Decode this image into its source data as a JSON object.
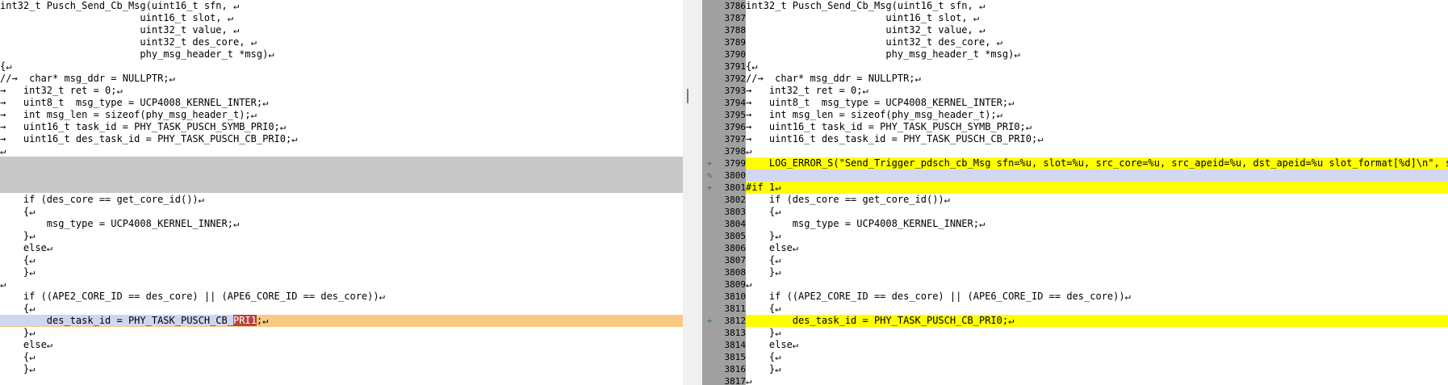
{
  "left": {
    "lines_top": [
      "int32_t Pusch_Send_Cb_Msg(uint16_t sfn, ↵",
      "                        uint16_t slot, ↵",
      "                        uint32_t value, ↵",
      "                        uint32_t des_core, ↵",
      "                        phy_msg_header_t *msg)↵",
      "{↵",
      "//→  char* msg_ddr = NULLPTR;↵",
      "→   int32_t ret = 0;↵",
      "→   uint8_t  msg_type = UCP4008_KERNEL_INTER;↵",
      "→   int msg_len = sizeof(phy_msg_header_t);↵",
      "→   uint16_t task_id = PHY_TASK_PUSCH_SYMB_PRI0;↵",
      "→   uint16_t des_task_id = PHY_TASK_PUSCH_CB_PRI0;↵",
      "↵"
    ],
    "lines_bottom": [
      "    if (des_core == get_core_id())↵",
      "    {↵",
      "        msg_type = UCP4008_KERNEL_INNER;↵",
      "    }↵",
      "    else↵",
      "    {↵",
      "    }↵",
      "↵",
      "    if ((APE2_CORE_ID == des_core) || (APE6_CORE_ID == des_core))↵",
      "    {↵"
    ],
    "changed_line": {
      "prefix": "        des_task_id = PHY_TASK_PUSCH_CB_",
      "deleted": "PRI1",
      "suffix": ";↵"
    },
    "lines_after": [
      "    }↵",
      "    else↵",
      "    {↵",
      "    }↵"
    ]
  },
  "right": {
    "lines": [
      {
        "n": "3786",
        "t": "int32_t Pusch_Send_Cb_Msg(uint16_t sfn, ↵"
      },
      {
        "n": "3787",
        "t": "                        uint16_t slot, ↵"
      },
      {
        "n": "3788",
        "t": "                        uint32_t value, ↵"
      },
      {
        "n": "3789",
        "t": "                        uint32_t des_core, ↵"
      },
      {
        "n": "3790",
        "t": "                        phy_msg_header_t *msg)↵"
      },
      {
        "n": "3791",
        "t": "{↵"
      },
      {
        "n": "3792",
        "t": "//→  char* msg_ddr = NULLPTR;↵"
      },
      {
        "n": "3793",
        "t": "→   int32_t ret = 0;↵"
      },
      {
        "n": "3794",
        "t": "→   uint8_t  msg_type = UCP4008_KERNEL_INTER;↵"
      },
      {
        "n": "3795",
        "t": "→   int msg_len = sizeof(phy_msg_header_t);↵"
      },
      {
        "n": "3796",
        "t": "→   uint16_t task_id = PHY_TASK_PUSCH_SYMB_PRI0;↵"
      },
      {
        "n": "3797",
        "t": "→   uint16_t des_task_id = PHY_TASK_PUSCH_CB_PRI0;↵"
      },
      {
        "n": "3798",
        "t": "↵"
      },
      {
        "n": "3799",
        "t": "    LOG_ERROR_S(\"Send_Trigger_pdsch_cb_Msg sfn=%u, slot=%u, src_core=%u, src_apeid=%u, dst_apeid=%u slot_format[%d]\\n\", sfn,",
        "hl": "yellow",
        "mark": "+"
      },
      {
        "n": "3800",
        "t": "",
        "hl": "lav",
        "mark": "✎"
      },
      {
        "n": "3801",
        "t": "#if 1↵",
        "hl": "yellow",
        "mark": "+"
      },
      {
        "n": "3802",
        "t": "    if (des_core == get_core_id())↵"
      },
      {
        "n": "3803",
        "t": "    {↵"
      },
      {
        "n": "3804",
        "t": "        msg_type = UCP4008_KERNEL_INNER;↵"
      },
      {
        "n": "3805",
        "t": "    }↵"
      },
      {
        "n": "3806",
        "t": "    else↵"
      },
      {
        "n": "3807",
        "t": "    {↵"
      },
      {
        "n": "3808",
        "t": "    }↵"
      },
      {
        "n": "3809",
        "t": "↵"
      },
      {
        "n": "3810",
        "t": "    if ((APE2_CORE_ID == des_core) || (APE6_CORE_ID == des_core))↵"
      },
      {
        "n": "3811",
        "t": "    {↵"
      },
      {
        "n": "3812",
        "t": "        des_task_id = PHY_TASK_PUSCH_CB_PRI0;↵",
        "hl": "yellow",
        "mark": "+"
      },
      {
        "n": "3813",
        "t": "    }↵"
      },
      {
        "n": "3814",
        "t": "    else↵"
      },
      {
        "n": "3815",
        "t": "    {↵"
      },
      {
        "n": "3816",
        "t": "    }↵"
      },
      {
        "n": "3817",
        "t": "↵"
      }
    ]
  },
  "colors": {
    "changed_left": "#f9c882",
    "added_right": "#ffff00",
    "deleted_segment": "#b5443f",
    "gutter": "#a0a0a0",
    "gap": "#c8c8c8"
  }
}
